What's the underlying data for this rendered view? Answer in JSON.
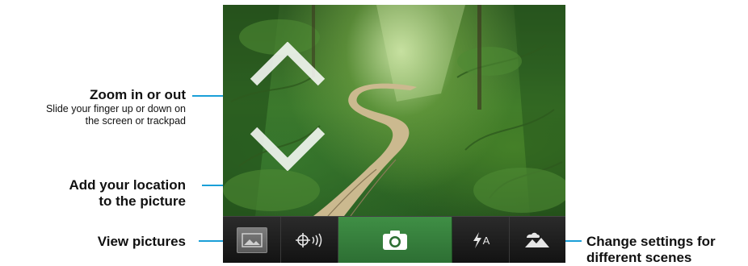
{
  "callouts": {
    "zoom": {
      "title": "Zoom in or out",
      "desc_line1": "Slide your finger up or down on",
      "desc_line2": "the screen or trackpad"
    },
    "location": {
      "title_line1": "Add your location",
      "title_line2": "to the picture"
    },
    "pictures": {
      "title": "View pictures"
    },
    "scenes": {
      "title_line1": "Change settings for",
      "title_line2": "different scenes"
    }
  },
  "toolbar": {
    "buttons": [
      {
        "id": "view-pictures",
        "icon": "picture-thumbnail-icon"
      },
      {
        "id": "geotag",
        "icon": "location-crosshair-icon"
      },
      {
        "id": "capture",
        "icon": "camera-icon"
      },
      {
        "id": "flash",
        "icon": "flash-auto-icon",
        "label": "A"
      },
      {
        "id": "scene-mode",
        "icon": "landscape-scene-icon"
      }
    ]
  },
  "colors": {
    "leader_line": "#1a9fd8",
    "capture_button": "#3a8a40",
    "toolbar": "#1b1b1b"
  }
}
